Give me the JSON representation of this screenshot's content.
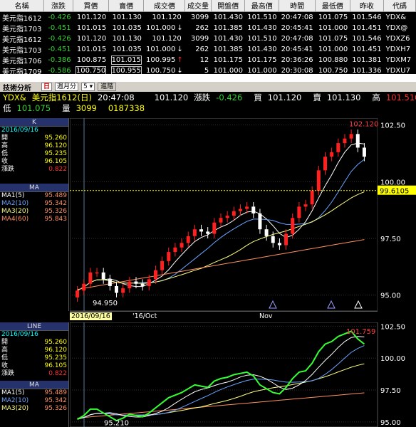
{
  "quote_table": {
    "headers": [
      "名稱",
      "漲跌",
      "買價",
      "賣價",
      "成交價",
      "成交量",
      "開盤價",
      "最高價",
      "時間",
      "最低價",
      "昨收",
      "代碼"
    ],
    "rows": [
      {
        "name": "美元指1612",
        "change": "-0.426",
        "bid": "101.120",
        "ask": "101.130",
        "last": "101.120",
        "arrow": "",
        "volume": "3099",
        "open": "101.430",
        "high": "101.510",
        "time": "20:47:08",
        "low": "101.075",
        "prev": "101.546",
        "code": "YDX&"
      },
      {
        "name": "美元指1703",
        "change": "-0.451",
        "bid": "101.015",
        "ask": "101.035",
        "last": "101.000",
        "arrow": "↓",
        "volume": "262",
        "open": "101.385",
        "high": "101.430",
        "time": "20:45:41",
        "low": "101.000",
        "prev": "101.451",
        "code": "YDX@"
      },
      {
        "name": "美元指1612",
        "change": "-0.426",
        "bid": "101.120",
        "ask": "101.130",
        "last": "101.120",
        "arrow": "",
        "volume": "3099",
        "open": "101.430",
        "high": "101.510",
        "time": "20:47:08",
        "low": "101.075",
        "prev": "101.546",
        "code": "YDXZ6"
      },
      {
        "name": "美元指1703",
        "change": "-0.451",
        "bid": "101.015",
        "ask": "101.035",
        "last": "101.000",
        "arrow": "↓",
        "volume": "262",
        "open": "101.385",
        "high": "101.430",
        "time": "20:45:41",
        "low": "101.000",
        "prev": "101.451",
        "code": "YDXH7"
      },
      {
        "name": "美元指1706",
        "change": "-0.386",
        "bid": "100.875",
        "ask": "101.015",
        "last": "100.995",
        "arrow": "↑",
        "volume": "12",
        "open": "101.175",
        "high": "101.175",
        "time": "20:36:26",
        "low": "100.880",
        "prev": "101.381",
        "code": "YDXM7"
      },
      {
        "name": "美元指1709",
        "change": "-0.586",
        "bid": "100.750",
        "ask": "100.955",
        "last": "100.750",
        "arrow": "↓",
        "volume": "5",
        "open": "101.000",
        "high": "101.000",
        "time": "20:30:08",
        "low": "100.750",
        "prev": "101.336",
        "code": "YDXU7"
      }
    ]
  },
  "toolbar": {
    "title": "技術分析",
    "day": "日",
    "period": "週月分",
    "interval": "5",
    "button": "進階"
  },
  "info": {
    "symbol": "YDX&",
    "name": "美元指1612(日)",
    "time": "20:47:08",
    "last": "101.120",
    "change_label": "漲跌",
    "change": "-0.426",
    "bid_label": "買",
    "bid": "101.120",
    "ask_label": "賣",
    "ask": "101.130",
    "high_label": "高",
    "high": "101.510",
    "low_label": "低",
    "low": "101.075",
    "vol_label": "量",
    "volume": "3099",
    "oi": "0187338"
  },
  "panel_k": {
    "header": "K",
    "date": "2016/09/16",
    "open_label": "開",
    "open": "95.260",
    "high_label": "高",
    "high": "96.120",
    "low_label": "低",
    "low": "95.235",
    "close_label": "收",
    "close": "96.105",
    "chg_label": "漲跌",
    "chg": "0.822"
  },
  "panel_ma": {
    "header": "MA",
    "items": [
      {
        "label": "MA1(5)",
        "value": "95.489",
        "color": "#ffffff"
      },
      {
        "label": "MA2(10)",
        "value": "95.342",
        "color": "#6aa4ff"
      },
      {
        "label": "MA3(20)",
        "value": "95.326",
        "color": "#ffff80"
      },
      {
        "label": "MA4(60)",
        "value": "95.843",
        "color": "#ff9060"
      }
    ]
  },
  "panel_line": {
    "header": "LINE",
    "date": "2016/09/16",
    "open_label": "開",
    "open": "95.260",
    "high_label": "高",
    "high": "96.120",
    "low_label": "低",
    "low": "95.235",
    "close_label": "收",
    "close": "96.105",
    "chg_label": "漲跌",
    "chg": "0.822"
  },
  "panel_ma2": {
    "header": "MA",
    "items": [
      {
        "label": "MA1(5)",
        "value": "95.489",
        "color": "#ffffff"
      },
      {
        "label": "MA2(10)",
        "value": "95.342",
        "color": "#6aa4ff"
      },
      {
        "label": "MA3(20)",
        "value": "95.326",
        "color": "#ffff80"
      }
    ]
  },
  "chart_data": [
    {
      "type": "candlestick",
      "title": "美元指1612(日)",
      "ylim": [
        94.3,
        102.8
      ],
      "yticks": [
        "102.50",
        "100.00",
        "97.50",
        "95.00"
      ],
      "last_price_label": "99.6105",
      "max_label": "102.120",
      "min_label": "94.950",
      "x_labels": [
        "2016/09/16",
        "'16/Oct",
        "Nov"
      ],
      "close": [
        95.2,
        95.5,
        96.0,
        96.0,
        95.7,
        95.4,
        95.1,
        95.3,
        95.6,
        95.5,
        95.4,
        95.7,
        96.1,
        96.5,
        96.9,
        97.1,
        97.3,
        97.6,
        97.9,
        97.8,
        97.7,
        98.2,
        98.4,
        98.5,
        98.7,
        98.8,
        98.9,
        98.6,
        97.9,
        97.6,
        97.3,
        97.2,
        97.7,
        98.4,
        98.9,
        99.0,
        99.6,
        100.5,
        101.1,
        101.3,
        101.7,
        101.9,
        102.1,
        101.5,
        101.1
      ],
      "ma_lines": [
        "MA1(5)",
        "MA2(10)",
        "MA3(20)",
        "MA4(60)"
      ]
    },
    {
      "type": "line",
      "ylim": [
        94.6,
        102.8
      ],
      "yticks": [
        "102.50",
        "100.00",
        "97.50",
        "95.00"
      ],
      "max_label": "101.759",
      "min_label": "95.210"
    }
  ]
}
